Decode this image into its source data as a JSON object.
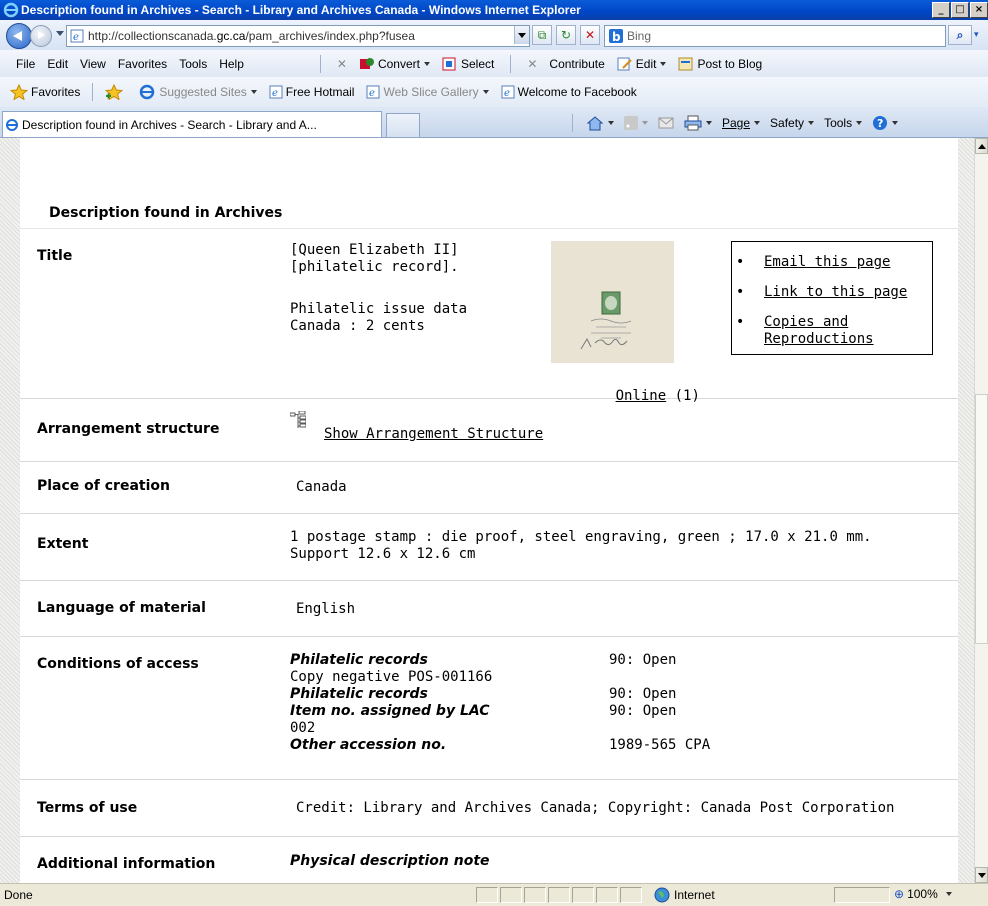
{
  "window": {
    "title": "Description found in Archives - Search - Library and Archives Canada - Windows Internet Explorer",
    "buttons": [
      "_",
      "□",
      "×"
    ]
  },
  "address": {
    "url_prefix": "http://collectionscanada.",
    "url_host": "gc.ca",
    "url_suffix": "/pam_archives/index.php?fusea",
    "search_placeholder": "Bing"
  },
  "menu": {
    "items": [
      "File",
      "Edit",
      "View",
      "Favorites",
      "Tools",
      "Help"
    ],
    "convert": "Convert",
    "select": "Select",
    "contribute": "Contribute",
    "edit": "Edit",
    "post_to_blog": "Post to Blog"
  },
  "favorites_bar": {
    "favorites": "Favorites",
    "suggested_sites": "Suggested Sites",
    "free_hotmail": "Free Hotmail",
    "web_slice_gallery": "Web Slice Gallery",
    "welcome_facebook": "Welcome to Facebook"
  },
  "tabs": {
    "active": "Description found in Archives - Search - Library and A...",
    "commands": [
      "Page",
      "Safety",
      "Tools"
    ]
  },
  "page": {
    "heading": "Description found in Archives",
    "sidebox_links": [
      "Email this page",
      "Link to this page",
      "Copies and\nReproductions"
    ],
    "online_link": "Online",
    "online_count": "(1)",
    "rows": {
      "title": {
        "label": "Title",
        "value": "[Queen Elizabeth II]\n[philatelic record].",
        "value2": "Philatelic issue data\nCanada : 2 cents"
      },
      "arrangement": {
        "label": "Arrangement structure",
        "link": "Show Arrangement Structure"
      },
      "place": {
        "label": "Place of creation",
        "value": "Canada"
      },
      "extent": {
        "label": "Extent",
        "value": "1 postage stamp : die proof, steel engraving, green ; 17.0 x 21.0 mm.\nSupport 12.6 x 12.6 cm"
      },
      "language": {
        "label": "Language of material",
        "value": "English"
      },
      "access": {
        "label": "Conditions of access",
        "entries": [
          {
            "name": "Philatelic records",
            "status": "90: Open"
          },
          {
            "plain": "Copy negative POS-001166"
          },
          {
            "name": "Philatelic records",
            "status": "90: Open"
          },
          {
            "name": "Item no. assigned by LAC",
            "status": "90: Open"
          },
          {
            "plain": "002"
          },
          {
            "name": "Other accession no.",
            "status": "1989-565 CPA"
          }
        ]
      },
      "terms": {
        "label": "Terms of use",
        "value": "Credit: Library and Archives Canada; Copyright: Canada Post Corporation"
      },
      "additional": {
        "label": "Additional information",
        "value": "Physical description note"
      }
    }
  },
  "status": {
    "text": "Done",
    "zone": "Internet",
    "zoom": "100%"
  },
  "colors": {
    "titlebar": "#0046c7",
    "ie_blue": "#1f6fd6"
  }
}
